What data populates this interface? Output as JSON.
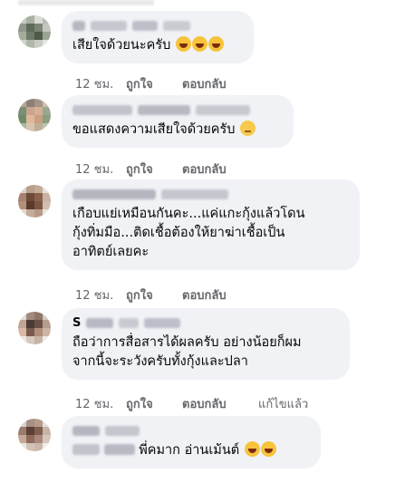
{
  "comments": [
    {
      "text_lines": [
        "เสียใจด้วยนะครับ"
      ],
      "emojis": [
        "laugh-emoji",
        "laugh-emoji",
        "laugh-emoji"
      ],
      "time": "12 ชม.",
      "like": "ถูกใจ",
      "reply": "ตอบกลับ"
    },
    {
      "text_lines": [
        "ขอแสดงความเสียใจด้วยครับ"
      ],
      "emojis": [
        "sad-emoji"
      ],
      "time": "12 ชม.",
      "like": "ถูกใจ",
      "reply": "ตอบกลับ"
    },
    {
      "text_lines": [
        "เกือบแย่เหมือนกันคะ...แค่แกะกุ้งแล้วโดน",
        "กุ้งทิ่มมือ...ติดเชื้อต้องให้ยาฆ่าเชื้อเป็น",
        "อาทิตย์เลยคะ"
      ],
      "emojis": [],
      "time": "12 ชม.",
      "like": "ถูกใจ",
      "reply": "ตอบกลับ"
    },
    {
      "name_initial": "S",
      "text_lines": [
        "ถือว่าการสื่อสารได้ผลครับ อย่างน้อยก็ผม",
        "จากนี้จะระวังครับทั้งกุ้งและปลา"
      ],
      "emojis": [],
      "time": "12 ชม.",
      "like": "ถูกใจ",
      "reply": "ตอบกลับ",
      "edited": "แก้ไขแล้ว"
    },
    {
      "text_lines": [
        "พี่คมาก อ่านเม้นต์"
      ],
      "emojis": [
        "crying-laugh-emoji",
        "crying-laugh-emoji"
      ],
      "time": "12 ชม.",
      "like": "ถูกใจ",
      "reply": "ตอบกลับ"
    }
  ],
  "colors": {
    "bubble": "#f0f2f5",
    "meta_text": "#65676b",
    "emoji_yellow": "#f7c33b"
  }
}
